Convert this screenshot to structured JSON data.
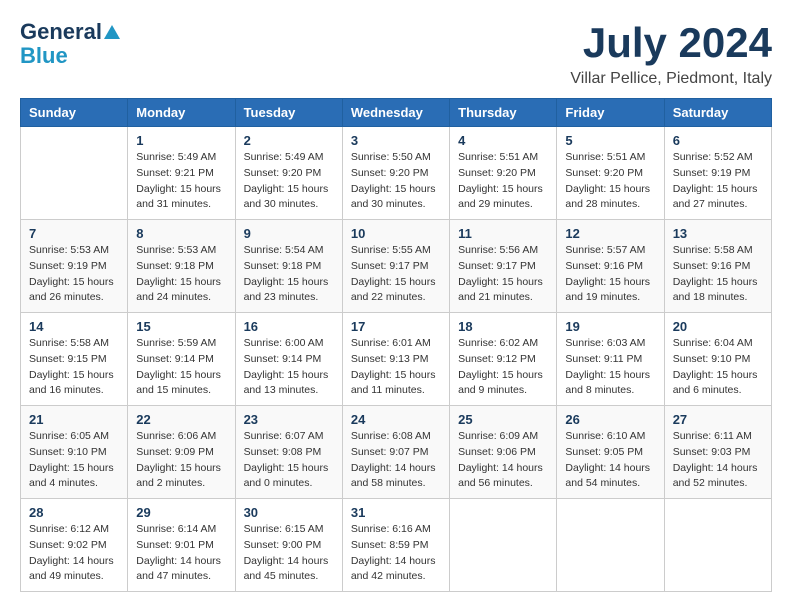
{
  "header": {
    "logo_line1": "General",
    "logo_line2": "Blue",
    "month": "July 2024",
    "location": "Villar Pellice, Piedmont, Italy"
  },
  "days_of_week": [
    "Sunday",
    "Monday",
    "Tuesday",
    "Wednesday",
    "Thursday",
    "Friday",
    "Saturday"
  ],
  "weeks": [
    [
      {
        "day": "",
        "sunrise": "",
        "sunset": "",
        "daylight": ""
      },
      {
        "day": "1",
        "sunrise": "5:49 AM",
        "sunset": "9:21 PM",
        "daylight": "15 hours and 31 minutes."
      },
      {
        "day": "2",
        "sunrise": "5:49 AM",
        "sunset": "9:20 PM",
        "daylight": "15 hours and 30 minutes."
      },
      {
        "day": "3",
        "sunrise": "5:50 AM",
        "sunset": "9:20 PM",
        "daylight": "15 hours and 30 minutes."
      },
      {
        "day": "4",
        "sunrise": "5:51 AM",
        "sunset": "9:20 PM",
        "daylight": "15 hours and 29 minutes."
      },
      {
        "day": "5",
        "sunrise": "5:51 AM",
        "sunset": "9:20 PM",
        "daylight": "15 hours and 28 minutes."
      },
      {
        "day": "6",
        "sunrise": "5:52 AM",
        "sunset": "9:19 PM",
        "daylight": "15 hours and 27 minutes."
      }
    ],
    [
      {
        "day": "7",
        "sunrise": "5:53 AM",
        "sunset": "9:19 PM",
        "daylight": "15 hours and 26 minutes."
      },
      {
        "day": "8",
        "sunrise": "5:53 AM",
        "sunset": "9:18 PM",
        "daylight": "15 hours and 24 minutes."
      },
      {
        "day": "9",
        "sunrise": "5:54 AM",
        "sunset": "9:18 PM",
        "daylight": "15 hours and 23 minutes."
      },
      {
        "day": "10",
        "sunrise": "5:55 AM",
        "sunset": "9:17 PM",
        "daylight": "15 hours and 22 minutes."
      },
      {
        "day": "11",
        "sunrise": "5:56 AM",
        "sunset": "9:17 PM",
        "daylight": "15 hours and 21 minutes."
      },
      {
        "day": "12",
        "sunrise": "5:57 AM",
        "sunset": "9:16 PM",
        "daylight": "15 hours and 19 minutes."
      },
      {
        "day": "13",
        "sunrise": "5:58 AM",
        "sunset": "9:16 PM",
        "daylight": "15 hours and 18 minutes."
      }
    ],
    [
      {
        "day": "14",
        "sunrise": "5:58 AM",
        "sunset": "9:15 PM",
        "daylight": "15 hours and 16 minutes."
      },
      {
        "day": "15",
        "sunrise": "5:59 AM",
        "sunset": "9:14 PM",
        "daylight": "15 hours and 15 minutes."
      },
      {
        "day": "16",
        "sunrise": "6:00 AM",
        "sunset": "9:14 PM",
        "daylight": "15 hours and 13 minutes."
      },
      {
        "day": "17",
        "sunrise": "6:01 AM",
        "sunset": "9:13 PM",
        "daylight": "15 hours and 11 minutes."
      },
      {
        "day": "18",
        "sunrise": "6:02 AM",
        "sunset": "9:12 PM",
        "daylight": "15 hours and 9 minutes."
      },
      {
        "day": "19",
        "sunrise": "6:03 AM",
        "sunset": "9:11 PM",
        "daylight": "15 hours and 8 minutes."
      },
      {
        "day": "20",
        "sunrise": "6:04 AM",
        "sunset": "9:10 PM",
        "daylight": "15 hours and 6 minutes."
      }
    ],
    [
      {
        "day": "21",
        "sunrise": "6:05 AM",
        "sunset": "9:10 PM",
        "daylight": "15 hours and 4 minutes."
      },
      {
        "day": "22",
        "sunrise": "6:06 AM",
        "sunset": "9:09 PM",
        "daylight": "15 hours and 2 minutes."
      },
      {
        "day": "23",
        "sunrise": "6:07 AM",
        "sunset": "9:08 PM",
        "daylight": "15 hours and 0 minutes."
      },
      {
        "day": "24",
        "sunrise": "6:08 AM",
        "sunset": "9:07 PM",
        "daylight": "14 hours and 58 minutes."
      },
      {
        "day": "25",
        "sunrise": "6:09 AM",
        "sunset": "9:06 PM",
        "daylight": "14 hours and 56 minutes."
      },
      {
        "day": "26",
        "sunrise": "6:10 AM",
        "sunset": "9:05 PM",
        "daylight": "14 hours and 54 minutes."
      },
      {
        "day": "27",
        "sunrise": "6:11 AM",
        "sunset": "9:03 PM",
        "daylight": "14 hours and 52 minutes."
      }
    ],
    [
      {
        "day": "28",
        "sunrise": "6:12 AM",
        "sunset": "9:02 PM",
        "daylight": "14 hours and 49 minutes."
      },
      {
        "day": "29",
        "sunrise": "6:14 AM",
        "sunset": "9:01 PM",
        "daylight": "14 hours and 47 minutes."
      },
      {
        "day": "30",
        "sunrise": "6:15 AM",
        "sunset": "9:00 PM",
        "daylight": "14 hours and 45 minutes."
      },
      {
        "day": "31",
        "sunrise": "6:16 AM",
        "sunset": "8:59 PM",
        "daylight": "14 hours and 42 minutes."
      },
      {
        "day": "",
        "sunrise": "",
        "sunset": "",
        "daylight": ""
      },
      {
        "day": "",
        "sunrise": "",
        "sunset": "",
        "daylight": ""
      },
      {
        "day": "",
        "sunrise": "",
        "sunset": "",
        "daylight": ""
      }
    ]
  ]
}
